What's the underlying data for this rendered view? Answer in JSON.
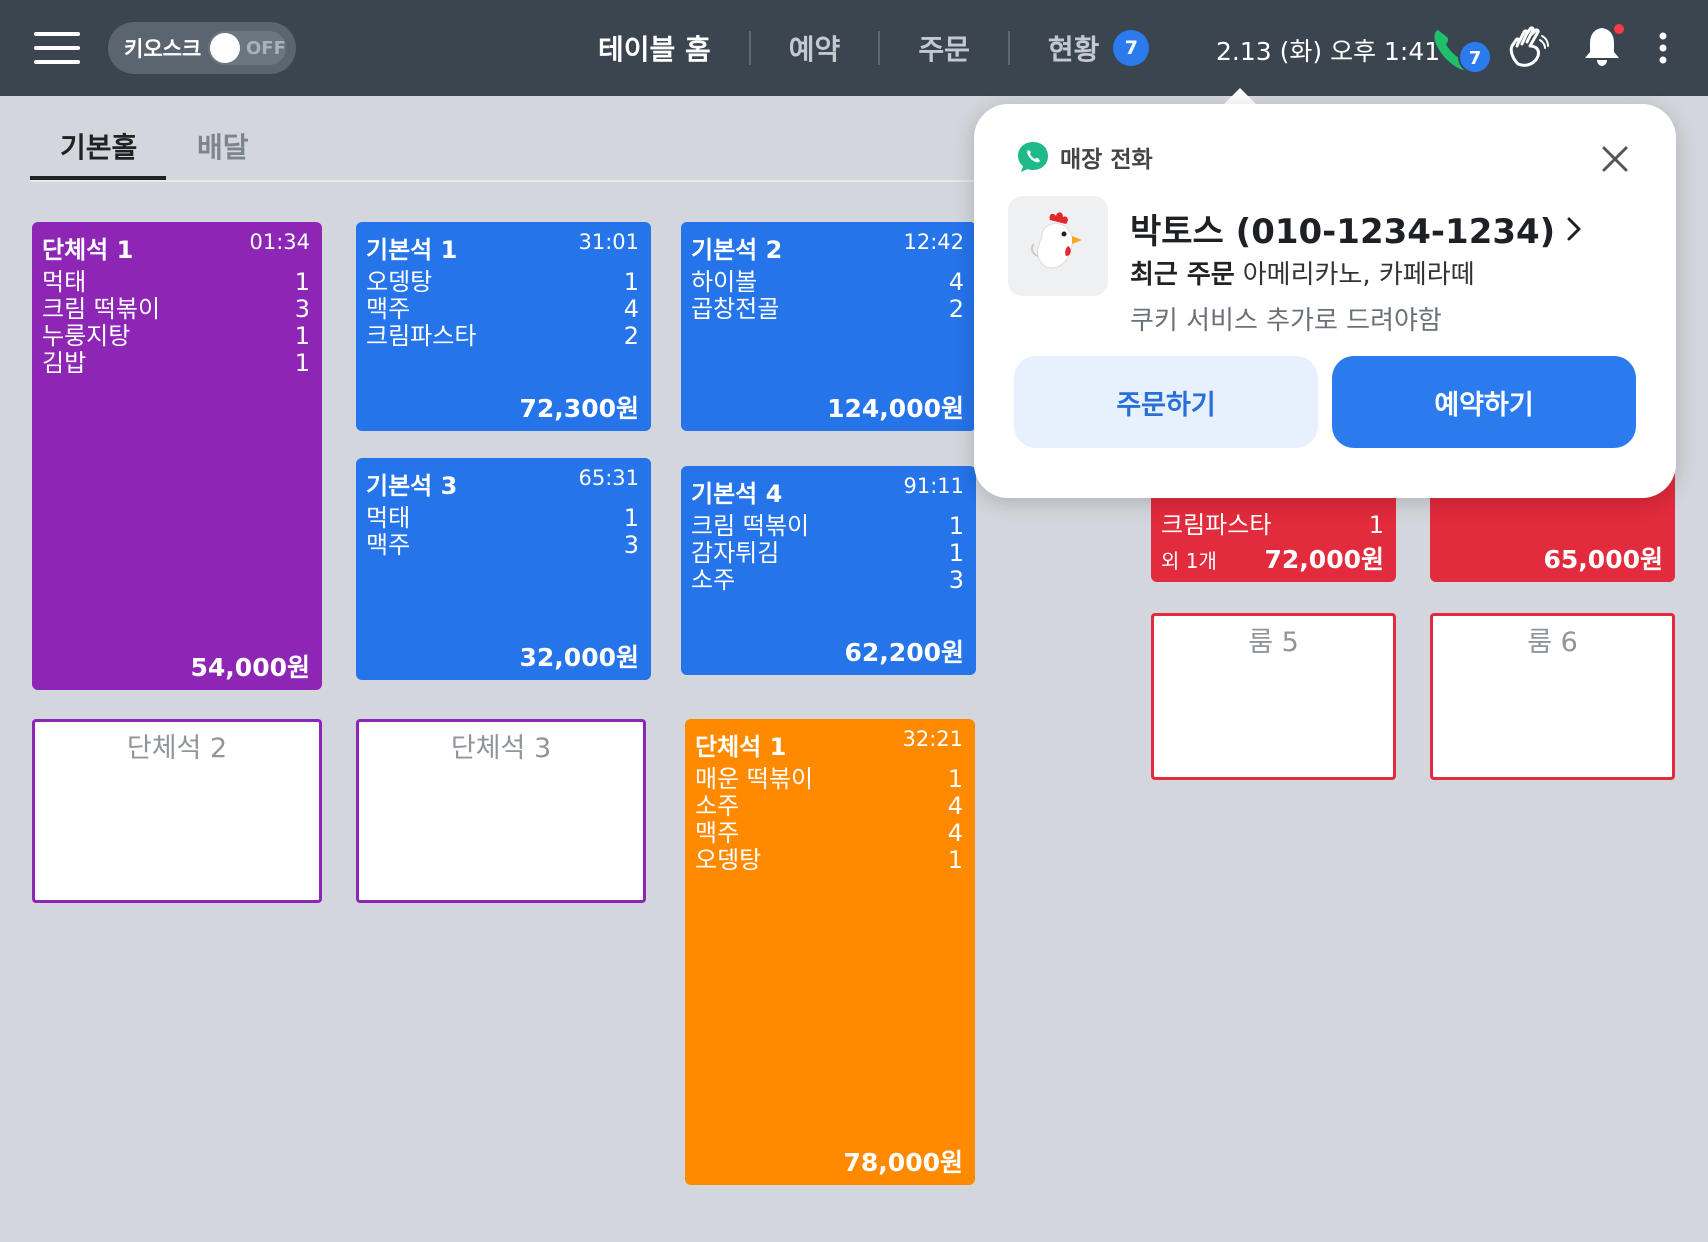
{
  "topbar": {
    "kiosk_label": "키오스크",
    "kiosk_state": "OFF",
    "nav": [
      {
        "label": "테이블 홈",
        "active": true
      },
      {
        "label": "예약",
        "active": false
      },
      {
        "label": "주문",
        "active": false
      },
      {
        "label": "현황",
        "active": false,
        "badge": "7"
      }
    ],
    "datetime": "2.13 (화) 오후 1:41",
    "call_badge": "7"
  },
  "tabs": [
    {
      "label": "기본홀",
      "active": true
    },
    {
      "label": "배달",
      "active": false
    }
  ],
  "tables": {
    "group1": {
      "name": "단체석 1",
      "time": "01:34",
      "items": [
        [
          "먹태",
          "1"
        ],
        [
          "크림 떡볶이",
          "3"
        ],
        [
          "누룽지탕",
          "1"
        ],
        [
          "김밥",
          "1"
        ]
      ],
      "total": "54,000원"
    },
    "basic1": {
      "name": "기본석 1",
      "time": "31:01",
      "items": [
        [
          "오뎅탕",
          "1"
        ],
        [
          "맥주",
          "4"
        ],
        [
          "크림파스타",
          "2"
        ]
      ],
      "total": "72,300원"
    },
    "basic2": {
      "name": "기본석 2",
      "time": "12:42",
      "items": [
        [
          "하이볼",
          "4"
        ],
        [
          "곱창전골",
          "2"
        ]
      ],
      "total": "124,000원"
    },
    "basic3": {
      "name": "기본석 3",
      "time": "65:31",
      "items": [
        [
          "먹태",
          "1"
        ],
        [
          "맥주",
          "3"
        ]
      ],
      "total": "32,000원"
    },
    "basic4": {
      "name": "기본석 4",
      "time": "91:11",
      "items": [
        [
          "크림 떡볶이",
          "1"
        ],
        [
          "감자튀김",
          "1"
        ],
        [
          "소주",
          "3"
        ]
      ],
      "total": "62,200원"
    },
    "group1b": {
      "name": "단체석 1",
      "time": "32:21",
      "items": [
        [
          "매운 떡볶이",
          "1"
        ],
        [
          "소주",
          "4"
        ],
        [
          "맥주",
          "4"
        ],
        [
          "오뎅탕",
          "1"
        ]
      ],
      "total": "78,000원"
    },
    "group2": {
      "name": "단체석 2"
    },
    "group3": {
      "name": "단체석 3"
    },
    "roomA": {
      "items": [
        [
          "크림파스타",
          "1"
        ]
      ],
      "extra": "외 1개",
      "total": "72,000원"
    },
    "roomB": {
      "total": "65,000원"
    },
    "room5": {
      "name": "룸 5"
    },
    "room6": {
      "name": "룸 6"
    }
  },
  "popup": {
    "label": "매장 전화",
    "caller": "박토스 (010-1234-1234)",
    "recent_label": "최근 주문",
    "recent_value": "아메리카노, 카페라떼",
    "memo": "쿠키 서비스 추가로 드려야함",
    "order_button": "주문하기",
    "reserve_button": "예약하기"
  },
  "colors": {
    "topbar": "#3b4550",
    "group": "#8e26b5",
    "basic": "#2574ea",
    "orange": "#ff8a00",
    "room": "#e22b3c",
    "accent": "#2b7bef"
  }
}
